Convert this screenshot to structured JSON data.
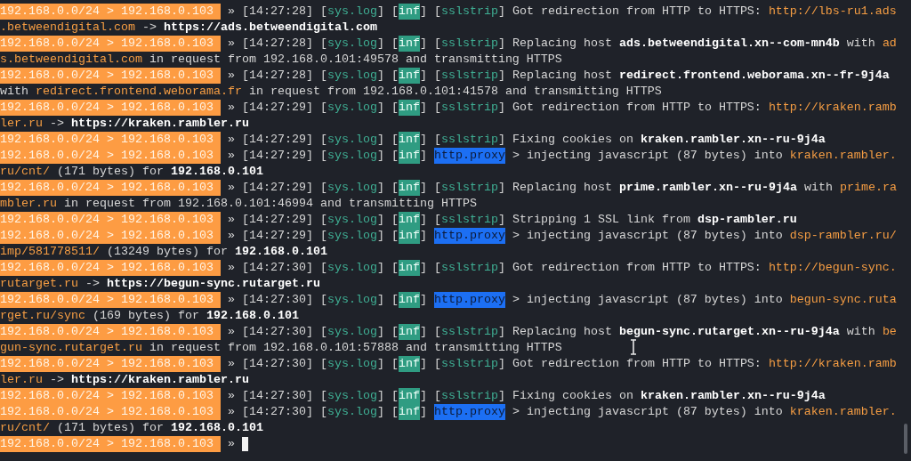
{
  "terminal": {
    "lines": [
      {
        "segs": [
          {
            "kind": "prompt",
            "text": "192.168.0.0/24 > 192.168.0.103 "
          },
          {
            "kind": "plain",
            "text": " » [14:27:28] ["
          },
          {
            "kind": "tag",
            "text": "sys.log"
          },
          {
            "kind": "plain",
            "text": "] ["
          },
          {
            "kind": "level",
            "text": "inf"
          },
          {
            "kind": "plain",
            "text": "] ["
          },
          {
            "kind": "tag",
            "text": "sslstrip"
          },
          {
            "kind": "plain",
            "text": "] Got redirection from HTTP to HTTPS: "
          },
          {
            "kind": "link",
            "text": "http://lbs-ru1.ads"
          }
        ]
      },
      {
        "segs": [
          {
            "kind": "link",
            "text": ".betweendigital.com"
          },
          {
            "kind": "plain",
            "text": " -> "
          },
          {
            "kind": "bold",
            "text": "https://ads.betweendigital.com"
          }
        ]
      },
      {
        "segs": [
          {
            "kind": "prompt",
            "text": "192.168.0.0/24 > 192.168.0.103 "
          },
          {
            "kind": "plain",
            "text": " » [14:27:28] ["
          },
          {
            "kind": "tag",
            "text": "sys.log"
          },
          {
            "kind": "plain",
            "text": "] ["
          },
          {
            "kind": "level",
            "text": "inf"
          },
          {
            "kind": "plain",
            "text": "] ["
          },
          {
            "kind": "tag",
            "text": "sslstrip"
          },
          {
            "kind": "plain",
            "text": "] Replacing host "
          },
          {
            "kind": "bold",
            "text": "ads.betweendigital.xn--com-mn4b"
          },
          {
            "kind": "plain",
            "text": " with "
          },
          {
            "kind": "link",
            "text": "ad"
          }
        ]
      },
      {
        "segs": [
          {
            "kind": "link",
            "text": "s.betweendigital.com"
          },
          {
            "kind": "plain",
            "text": " in request from 192.168.0.101:49578 and transmitting HTTPS"
          }
        ]
      },
      {
        "segs": [
          {
            "kind": "prompt",
            "text": "192.168.0.0/24 > 192.168.0.103 "
          },
          {
            "kind": "plain",
            "text": " » [14:27:28] ["
          },
          {
            "kind": "tag",
            "text": "sys.log"
          },
          {
            "kind": "plain",
            "text": "] ["
          },
          {
            "kind": "level",
            "text": "inf"
          },
          {
            "kind": "plain",
            "text": "] ["
          },
          {
            "kind": "tag",
            "text": "sslstrip"
          },
          {
            "kind": "plain",
            "text": "] Replacing host "
          },
          {
            "kind": "bold",
            "text": "redirect.frontend.weborama.xn--fr-9j4a"
          }
        ]
      },
      {
        "segs": [
          {
            "kind": "plain",
            "text": "with "
          },
          {
            "kind": "link",
            "text": "redirect.frontend.weborama.fr"
          },
          {
            "kind": "plain",
            "text": " in request from 192.168.0.101:41578 and transmitting HTTPS"
          }
        ]
      },
      {
        "segs": [
          {
            "kind": "prompt",
            "text": "192.168.0.0/24 > 192.168.0.103 "
          },
          {
            "kind": "plain",
            "text": " » [14:27:29] ["
          },
          {
            "kind": "tag",
            "text": "sys.log"
          },
          {
            "kind": "plain",
            "text": "] ["
          },
          {
            "kind": "level",
            "text": "inf"
          },
          {
            "kind": "plain",
            "text": "] ["
          },
          {
            "kind": "tag",
            "text": "sslstrip"
          },
          {
            "kind": "plain",
            "text": "] Got redirection from HTTP to HTTPS: "
          },
          {
            "kind": "link",
            "text": "http://kraken.ramb"
          }
        ]
      },
      {
        "segs": [
          {
            "kind": "link",
            "text": "ler.ru"
          },
          {
            "kind": "plain",
            "text": " -> "
          },
          {
            "kind": "bold",
            "text": "https://kraken.rambler.ru"
          }
        ]
      },
      {
        "segs": [
          {
            "kind": "prompt",
            "text": "192.168.0.0/24 > 192.168.0.103 "
          },
          {
            "kind": "plain",
            "text": " » [14:27:29] ["
          },
          {
            "kind": "tag",
            "text": "sys.log"
          },
          {
            "kind": "plain",
            "text": "] ["
          },
          {
            "kind": "level",
            "text": "inf"
          },
          {
            "kind": "plain",
            "text": "] ["
          },
          {
            "kind": "tag",
            "text": "sslstrip"
          },
          {
            "kind": "plain",
            "text": "] Fixing cookies on "
          },
          {
            "kind": "bold",
            "text": "kraken.rambler.xn--ru-9j4a"
          }
        ]
      },
      {
        "segs": [
          {
            "kind": "prompt",
            "text": "192.168.0.0/24 > 192.168.0.103 "
          },
          {
            "kind": "plain",
            "text": " » [14:27:29] ["
          },
          {
            "kind": "tag",
            "text": "sys.log"
          },
          {
            "kind": "plain",
            "text": "] ["
          },
          {
            "kind": "level",
            "text": "inf"
          },
          {
            "kind": "plain",
            "text": "] "
          },
          {
            "kind": "module",
            "text": "http.proxy"
          },
          {
            "kind": "plain",
            "text": " > injecting javascript (87 bytes) into "
          },
          {
            "kind": "link",
            "text": "kraken.rambler."
          }
        ]
      },
      {
        "segs": [
          {
            "kind": "link",
            "text": "ru/cnt/"
          },
          {
            "kind": "plain",
            "text": " (171 bytes) for "
          },
          {
            "kind": "bold",
            "text": "192.168.0.101"
          }
        ]
      },
      {
        "segs": [
          {
            "kind": "prompt",
            "text": "192.168.0.0/24 > 192.168.0.103 "
          },
          {
            "kind": "plain",
            "text": " » [14:27:29] ["
          },
          {
            "kind": "tag",
            "text": "sys.log"
          },
          {
            "kind": "plain",
            "text": "] ["
          },
          {
            "kind": "level",
            "text": "inf"
          },
          {
            "kind": "plain",
            "text": "] ["
          },
          {
            "kind": "tag",
            "text": "sslstrip"
          },
          {
            "kind": "plain",
            "text": "] Replacing host "
          },
          {
            "kind": "bold",
            "text": "prime.rambler.xn--ru-9j4a"
          },
          {
            "kind": "plain",
            "text": " with "
          },
          {
            "kind": "link",
            "text": "prime.ra"
          }
        ]
      },
      {
        "segs": [
          {
            "kind": "link",
            "text": "mbler.ru"
          },
          {
            "kind": "plain",
            "text": " in request from 192.168.0.101:46994 and transmitting HTTPS"
          }
        ]
      },
      {
        "segs": [
          {
            "kind": "prompt",
            "text": "192.168.0.0/24 > 192.168.0.103 "
          },
          {
            "kind": "plain",
            "text": " » [14:27:29] ["
          },
          {
            "kind": "tag",
            "text": "sys.log"
          },
          {
            "kind": "plain",
            "text": "] ["
          },
          {
            "kind": "level",
            "text": "inf"
          },
          {
            "kind": "plain",
            "text": "] ["
          },
          {
            "kind": "tag",
            "text": "sslstrip"
          },
          {
            "kind": "plain",
            "text": "] Stripping 1 SSL link from "
          },
          {
            "kind": "bold",
            "text": "dsp-rambler.ru"
          }
        ]
      },
      {
        "segs": [
          {
            "kind": "prompt",
            "text": "192.168.0.0/24 > 192.168.0.103 "
          },
          {
            "kind": "plain",
            "text": " » [14:27:29] ["
          },
          {
            "kind": "tag",
            "text": "sys.log"
          },
          {
            "kind": "plain",
            "text": "] ["
          },
          {
            "kind": "level",
            "text": "inf"
          },
          {
            "kind": "plain",
            "text": "] "
          },
          {
            "kind": "module",
            "text": "http.proxy"
          },
          {
            "kind": "plain",
            "text": " > injecting javascript (87 bytes) into "
          },
          {
            "kind": "link",
            "text": "dsp-rambler.ru/"
          }
        ]
      },
      {
        "segs": [
          {
            "kind": "link",
            "text": "imp/581778511/"
          },
          {
            "kind": "plain",
            "text": " (13249 bytes) for "
          },
          {
            "kind": "bold",
            "text": "192.168.0.101"
          }
        ]
      },
      {
        "segs": [
          {
            "kind": "prompt",
            "text": "192.168.0.0/24 > 192.168.0.103 "
          },
          {
            "kind": "plain",
            "text": " » [14:27:30] ["
          },
          {
            "kind": "tag",
            "text": "sys.log"
          },
          {
            "kind": "plain",
            "text": "] ["
          },
          {
            "kind": "level",
            "text": "inf"
          },
          {
            "kind": "plain",
            "text": "] ["
          },
          {
            "kind": "tag",
            "text": "sslstrip"
          },
          {
            "kind": "plain",
            "text": "] Got redirection from HTTP to HTTPS: "
          },
          {
            "kind": "link",
            "text": "http://begun-sync."
          }
        ]
      },
      {
        "segs": [
          {
            "kind": "link",
            "text": "rutarget.ru"
          },
          {
            "kind": "plain",
            "text": " -> "
          },
          {
            "kind": "bold",
            "text": "https://begun-sync.rutarget.ru"
          }
        ]
      },
      {
        "segs": [
          {
            "kind": "prompt",
            "text": "192.168.0.0/24 > 192.168.0.103 "
          },
          {
            "kind": "plain",
            "text": " » [14:27:30] ["
          },
          {
            "kind": "tag",
            "text": "sys.log"
          },
          {
            "kind": "plain",
            "text": "] ["
          },
          {
            "kind": "level",
            "text": "inf"
          },
          {
            "kind": "plain",
            "text": "] "
          },
          {
            "kind": "module",
            "text": "http.proxy"
          },
          {
            "kind": "plain",
            "text": " > injecting javascript (87 bytes) into "
          },
          {
            "kind": "link",
            "text": "begun-sync.ruta"
          }
        ]
      },
      {
        "segs": [
          {
            "kind": "link",
            "text": "rget.ru/sync"
          },
          {
            "kind": "plain",
            "text": " (169 bytes) for "
          },
          {
            "kind": "bold",
            "text": "192.168.0.101"
          }
        ]
      },
      {
        "segs": [
          {
            "kind": "prompt",
            "text": "192.168.0.0/24 > 192.168.0.103 "
          },
          {
            "kind": "plain",
            "text": " » [14:27:30] ["
          },
          {
            "kind": "tag",
            "text": "sys.log"
          },
          {
            "kind": "plain",
            "text": "] ["
          },
          {
            "kind": "level",
            "text": "inf"
          },
          {
            "kind": "plain",
            "text": "] ["
          },
          {
            "kind": "tag",
            "text": "sslstrip"
          },
          {
            "kind": "plain",
            "text": "] Replacing host "
          },
          {
            "kind": "bold",
            "text": "begun-sync.rutarget.xn--ru-9j4a"
          },
          {
            "kind": "plain",
            "text": " with "
          },
          {
            "kind": "link",
            "text": "be"
          }
        ]
      },
      {
        "segs": [
          {
            "kind": "link",
            "text": "gun-sync.rutarget.ru"
          },
          {
            "kind": "plain",
            "text": " in request from 192.168.0.101:57888 and transmitting HTTPS"
          }
        ]
      },
      {
        "segs": [
          {
            "kind": "prompt",
            "text": "192.168.0.0/24 > 192.168.0.103 "
          },
          {
            "kind": "plain",
            "text": " » [14:27:30] ["
          },
          {
            "kind": "tag",
            "text": "sys.log"
          },
          {
            "kind": "plain",
            "text": "] ["
          },
          {
            "kind": "level",
            "text": "inf"
          },
          {
            "kind": "plain",
            "text": "] ["
          },
          {
            "kind": "tag",
            "text": "sslstrip"
          },
          {
            "kind": "plain",
            "text": "] Got redirection from HTTP to HTTPS: "
          },
          {
            "kind": "link",
            "text": "http://kraken.ramb"
          }
        ]
      },
      {
        "segs": [
          {
            "kind": "link",
            "text": "ler.ru"
          },
          {
            "kind": "plain",
            "text": " -> "
          },
          {
            "kind": "bold",
            "text": "https://kraken.rambler.ru"
          }
        ]
      },
      {
        "segs": [
          {
            "kind": "prompt",
            "text": "192.168.0.0/24 > 192.168.0.103 "
          },
          {
            "kind": "plain",
            "text": " » [14:27:30] ["
          },
          {
            "kind": "tag",
            "text": "sys.log"
          },
          {
            "kind": "plain",
            "text": "] ["
          },
          {
            "kind": "level",
            "text": "inf"
          },
          {
            "kind": "plain",
            "text": "] ["
          },
          {
            "kind": "tag",
            "text": "sslstrip"
          },
          {
            "kind": "plain",
            "text": "] Fixing cookies on "
          },
          {
            "kind": "bold",
            "text": "kraken.rambler.xn--ru-9j4a"
          }
        ]
      },
      {
        "segs": [
          {
            "kind": "prompt",
            "text": "192.168.0.0/24 > 192.168.0.103 "
          },
          {
            "kind": "plain",
            "text": " » [14:27:30] ["
          },
          {
            "kind": "tag",
            "text": "sys.log"
          },
          {
            "kind": "plain",
            "text": "] ["
          },
          {
            "kind": "level",
            "text": "inf"
          },
          {
            "kind": "plain",
            "text": "] "
          },
          {
            "kind": "module",
            "text": "http.proxy"
          },
          {
            "kind": "plain",
            "text": " > injecting javascript (87 bytes) into "
          },
          {
            "kind": "link",
            "text": "kraken.rambler."
          }
        ]
      },
      {
        "segs": [
          {
            "kind": "link",
            "text": "ru/cnt/"
          },
          {
            "kind": "plain",
            "text": " (171 bytes) for "
          },
          {
            "kind": "bold",
            "text": "192.168.0.101"
          }
        ]
      },
      {
        "segs": [
          {
            "kind": "prompt",
            "text": "192.168.0.0/24 > 192.168.0.103 "
          },
          {
            "kind": "plain",
            "text": " » "
          }
        ],
        "cursor": true
      }
    ]
  }
}
